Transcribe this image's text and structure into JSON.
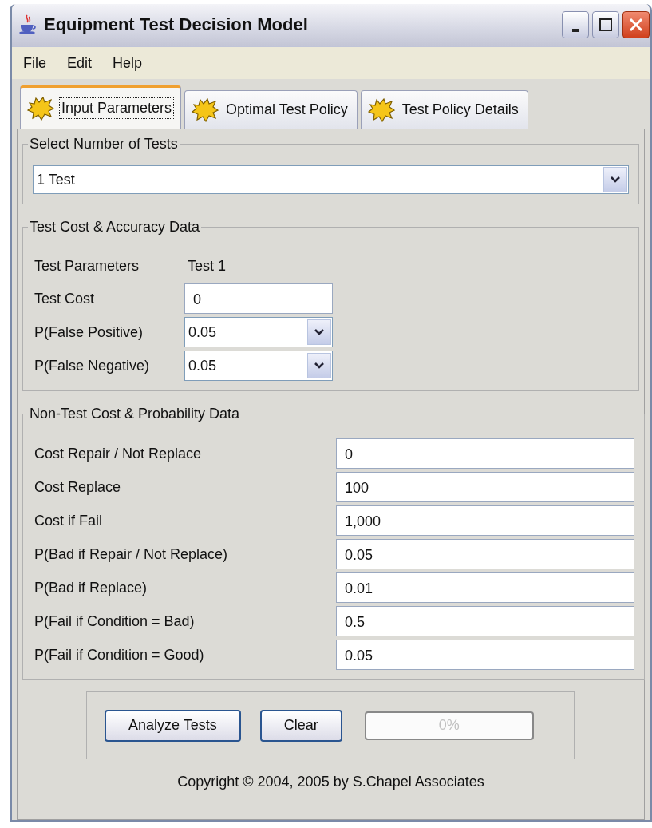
{
  "window": {
    "title": "Equipment Test Decision Model"
  },
  "menu": [
    "File",
    "Edit",
    "Help"
  ],
  "tabs": [
    {
      "label": "Input Parameters",
      "selected": true
    },
    {
      "label": "Optimal Test Policy",
      "selected": false
    },
    {
      "label": "Test Policy Details",
      "selected": false
    }
  ],
  "number_of_tests": {
    "title": "Select Number of Tests",
    "value": "1 Test"
  },
  "test_data": {
    "title": "Test Cost & Accuracy Data",
    "header": [
      "Test Parameters",
      "Test 1"
    ],
    "rows": [
      {
        "label": "Test Cost",
        "kind": "text",
        "value": "0"
      },
      {
        "label": "P(False Positive)",
        "kind": "combo",
        "value": "0.05"
      },
      {
        "label": "P(False Negative)",
        "kind": "combo",
        "value": "0.05"
      }
    ]
  },
  "non_test_data": {
    "title": "Non-Test Cost & Probability Data",
    "rows": [
      {
        "label": "Cost Repair / Not Replace",
        "value": "0"
      },
      {
        "label": "Cost Replace",
        "value": "100"
      },
      {
        "label": "Cost if Fail",
        "value": "1,000"
      },
      {
        "label": "P(Bad if Repair / Not Replace)",
        "value": "0.05"
      },
      {
        "label": "P(Bad if Replace)",
        "value": "0.01"
      },
      {
        "label": "P(Fail if Condition = Bad)",
        "value": "0.5"
      },
      {
        "label": "P(Fail if Condition = Good)",
        "value": "0.05"
      }
    ]
  },
  "buttons": [
    "Analyze Tests",
    "Clear"
  ],
  "progress": {
    "level": 0,
    "text": "0%"
  },
  "footer": "Copyright © 2004, 2005 by S.Chapel Associates"
}
